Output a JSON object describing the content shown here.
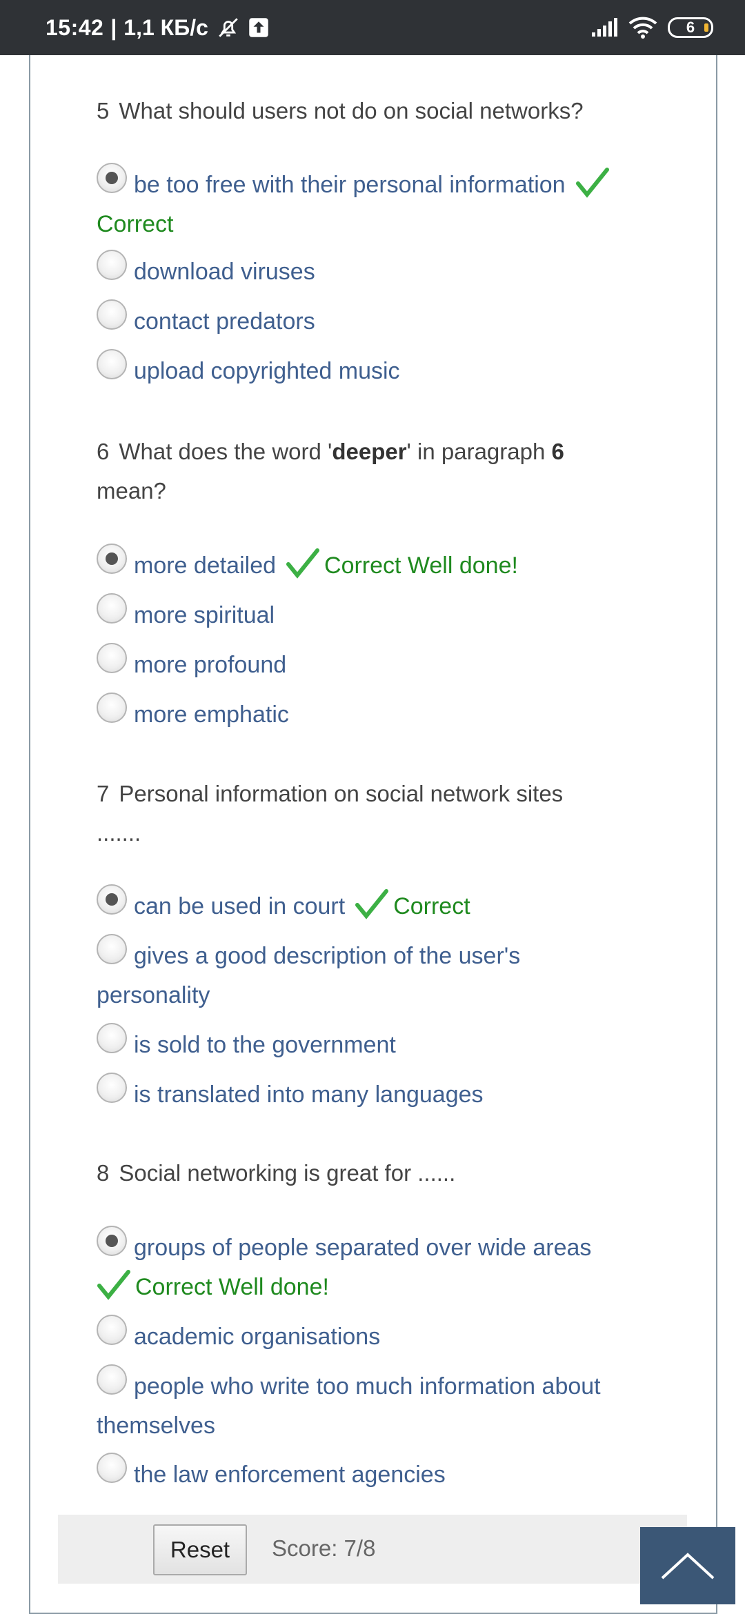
{
  "status_bar": {
    "time": "15:42",
    "separator": "|",
    "speed": "1,1 КБ/с",
    "battery": "6",
    "icons": [
      "mute-bell-icon",
      "upload-icon",
      "signal-icon",
      "wifi-icon",
      "battery-icon"
    ]
  },
  "questions": [
    {
      "number": "5",
      "text_parts": [
        "What should users not do on social networks?"
      ],
      "options": [
        {
          "label": "be too free with their personal information",
          "selected": true,
          "feedback": "Correct"
        },
        {
          "label": "download viruses",
          "selected": false
        },
        {
          "label": "contact predators",
          "selected": false
        },
        {
          "label": "upload copyrighted music",
          "selected": false
        }
      ]
    },
    {
      "number": "6",
      "text_before": "What does the word '",
      "text_bold": "deeper",
      "text_middle": "' in paragraph ",
      "text_bold2": "6",
      "text_after": "mean?",
      "options": [
        {
          "label": "more detailed",
          "selected": true,
          "feedback": "Correct Well done!"
        },
        {
          "label": "more spiritual",
          "selected": false
        },
        {
          "label": "more profound",
          "selected": false
        },
        {
          "label": "more emphatic",
          "selected": false
        }
      ]
    },
    {
      "number": "7",
      "text_line1": "Personal information on social network sites",
      "text_line2": ".......",
      "options": [
        {
          "label": "can be used in court",
          "selected": true,
          "feedback": "Correct"
        },
        {
          "label": "gives a good description of the user's",
          "label_cont": "personality",
          "selected": false
        },
        {
          "label": "is sold to the government",
          "selected": false
        },
        {
          "label": "is translated into many languages",
          "selected": false
        }
      ]
    },
    {
      "number": "8",
      "text": "Social networking is great for ......",
      "options": [
        {
          "label": "groups of people separated over wide areas",
          "selected": true,
          "feedback": "Correct Well done!"
        },
        {
          "label": "academic organisations",
          "selected": false
        },
        {
          "label": "people who write too much information about",
          "label_cont": "themselves",
          "selected": false
        },
        {
          "label": "the law enforcement agencies",
          "selected": false
        }
      ]
    }
  ],
  "footer": {
    "reset_label": "Reset",
    "score_text": "Score: 7/8"
  },
  "colors": {
    "status_bg": "#2f3236",
    "option_text": "#3f5f8f",
    "correct_text": "#1f8a1f",
    "scroll_button": "#3b5776"
  }
}
